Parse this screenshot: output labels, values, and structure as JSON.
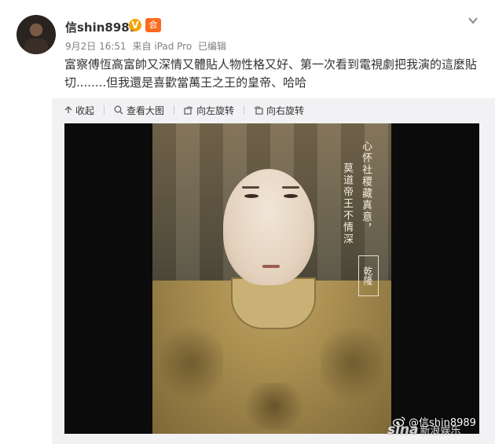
{
  "user": {
    "name": "信shin8989",
    "verified_glyph": "V",
    "member_glyph": "会",
    "avatar_icon": "avatar"
  },
  "meta": {
    "date": "9月2日 16:51",
    "source": "来自 iPad Pro",
    "edited": "已编辑"
  },
  "post": {
    "text": "富察傅恆高富帥又深情又體貼人物性格又好、第一次看到電視劇把我演的這麼貼切........但我還是喜歡當萬王之王的皇帝、哈哈"
  },
  "toolbar": {
    "collapse": "收起",
    "view_large": "查看大图",
    "rotate_left": "向左旋转",
    "rotate_right": "向右旋转"
  },
  "image": {
    "poem_line_1": "心怀社稷藏真意，",
    "poem_line_2": "莫道帝王不情深",
    "seal_text": "乾隆"
  },
  "watermark": {
    "handle": "@信shin8989",
    "brand": "sina",
    "brand_sub": "新浪娱乐"
  },
  "colors": {
    "accent_orange": "#fb6a21",
    "verified_gold": "#f5a200",
    "link_gray": "#808080"
  }
}
